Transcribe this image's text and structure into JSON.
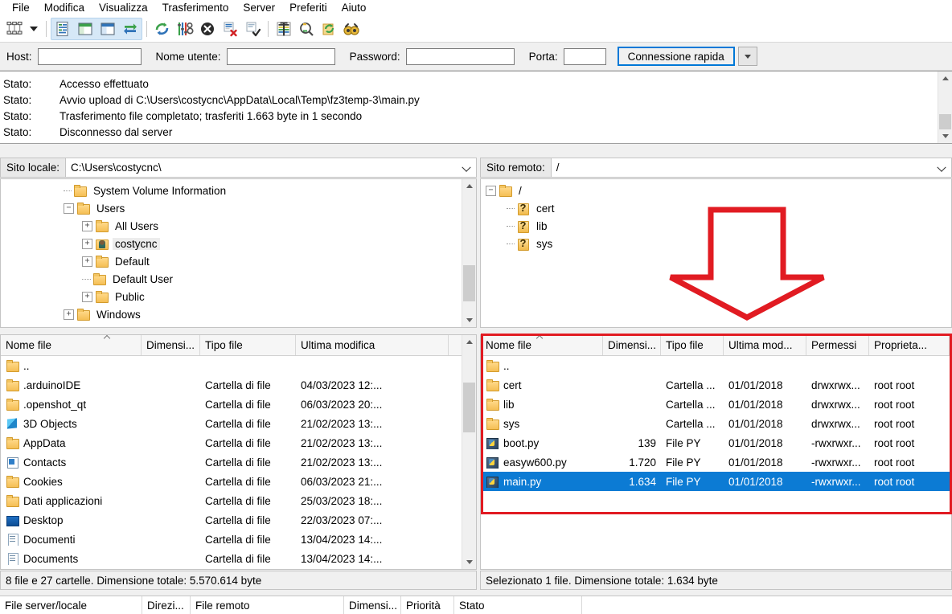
{
  "menu": {
    "items": [
      "File",
      "Modifica",
      "Visualizza",
      "Trasferimento",
      "Server",
      "Preferiti",
      "Aiuto"
    ]
  },
  "toolbar": {
    "icons": [
      "site-manager-icon",
      "site-manager-dropdown-caret",
      "toggle-message-log-icon",
      "toggle-local-tree-icon",
      "toggle-remote-tree-icon",
      "toggle-transfer-queue-icon",
      "refresh-icon",
      "process-queue-icon",
      "cancel-operation-icon",
      "disconnect-icon",
      "reconnect-icon",
      "filter-icon",
      "compare-directories-icon",
      "synchronized-browsing-icon",
      "find-files-icon"
    ]
  },
  "connection": {
    "host_label": "Host:",
    "host_value": "",
    "username_label": "Nome utente:",
    "username_value": "",
    "password_label": "Password:",
    "password_value": "",
    "port_label": "Porta:",
    "port_value": "",
    "quickconnect_label": "Connessione rapida"
  },
  "log": {
    "rows": [
      {
        "key": "Stato:",
        "text": "Accesso effettuato"
      },
      {
        "key": "Stato:",
        "text": "Avvio upload di C:\\Users\\costycnc\\AppData\\Local\\Temp\\fz3temp-3\\main.py"
      },
      {
        "key": "Stato:",
        "text": "Trasferimento file completato; trasferiti 1.663 byte in 1 secondo"
      },
      {
        "key": "Stato:",
        "text": "Disconnesso dal server"
      }
    ]
  },
  "local": {
    "path_label": "Sito locale:",
    "path_value": "C:\\Users\\costycnc\\",
    "tree": [
      {
        "label": "System Volume Information",
        "indent": 2,
        "expander": "",
        "icon": "folder-icon",
        "selected": false
      },
      {
        "label": "Users",
        "indent": 1,
        "expander": "-",
        "icon": "folder-icon",
        "selected": false
      },
      {
        "label": "All Users",
        "indent": 2,
        "expander": "+",
        "icon": "folder-icon",
        "selected": false
      },
      {
        "label": "costycnc",
        "indent": 2,
        "expander": "+",
        "icon": "user-folder-icon",
        "selected": true
      },
      {
        "label": "Default",
        "indent": 2,
        "expander": "+",
        "icon": "folder-icon",
        "selected": false
      },
      {
        "label": "Default User",
        "indent": 2,
        "expander": "",
        "icon": "folder-icon",
        "selected": false
      },
      {
        "label": "Public",
        "indent": 2,
        "expander": "+",
        "icon": "folder-icon",
        "selected": false
      },
      {
        "label": "Windows",
        "indent": 1,
        "expander": "+",
        "icon": "folder-icon",
        "selected": false
      }
    ],
    "columns": [
      "Nome file",
      "Dimensi...",
      "Tipo file",
      "Ultima modifica"
    ],
    "sorted_column": 0,
    "rows": [
      {
        "name": "..",
        "size": "",
        "type": "",
        "modified": "",
        "icon": "folder-icon"
      },
      {
        "name": ".arduinoIDE",
        "size": "",
        "type": "Cartella di file",
        "modified": "04/03/2023 12:...",
        "icon": "folder-icon"
      },
      {
        "name": ".openshot_qt",
        "size": "",
        "type": "Cartella di file",
        "modified": "06/03/2023 20:...",
        "icon": "folder-icon"
      },
      {
        "name": "3D Objects",
        "size": "",
        "type": "Cartella di file",
        "modified": "21/02/2023 13:...",
        "icon": "3d-objects-icon"
      },
      {
        "name": "AppData",
        "size": "",
        "type": "Cartella di file",
        "modified": "21/02/2023 13:...",
        "icon": "folder-icon"
      },
      {
        "name": "Contacts",
        "size": "",
        "type": "Cartella di file",
        "modified": "21/02/2023 13:...",
        "icon": "contacts-icon"
      },
      {
        "name": "Cookies",
        "size": "",
        "type": "Cartella di file",
        "modified": "06/03/2023 21:...",
        "icon": "folder-icon"
      },
      {
        "name": "Dati applicazioni",
        "size": "",
        "type": "Cartella di file",
        "modified": "25/03/2023 18:...",
        "icon": "folder-icon"
      },
      {
        "name": "Desktop",
        "size": "",
        "type": "Cartella di file",
        "modified": "22/03/2023 07:...",
        "icon": "desktop-icon"
      },
      {
        "name": "Documenti",
        "size": "",
        "type": "Cartella di file",
        "modified": "13/04/2023 14:...",
        "icon": "documents-icon"
      },
      {
        "name": "Documents",
        "size": "",
        "type": "Cartella di file",
        "modified": "13/04/2023 14:...",
        "icon": "documents-icon"
      }
    ],
    "status": "8 file e 27 cartelle. Dimensione totale: 5.570.614 byte"
  },
  "remote": {
    "path_label": "Sito remoto:",
    "path_value": "/",
    "tree": [
      {
        "label": "/",
        "indent": 0,
        "expander": "-",
        "icon": "folder-icon"
      },
      {
        "label": "cert",
        "indent": 1,
        "expander": "",
        "icon": "unknown-folder-icon"
      },
      {
        "label": "lib",
        "indent": 1,
        "expander": "",
        "icon": "unknown-folder-icon"
      },
      {
        "label": "sys",
        "indent": 1,
        "expander": "",
        "icon": "unknown-folder-icon"
      }
    ],
    "columns": [
      "Nome file",
      "Dimensi...",
      "Tipo file",
      "Ultima mod...",
      "Permessi",
      "Proprieta..."
    ],
    "sorted_column": 0,
    "rows": [
      {
        "name": "..",
        "size": "",
        "type": "",
        "modified": "",
        "perms": "",
        "owner": "",
        "icon": "folder-icon",
        "selected": false
      },
      {
        "name": "cert",
        "size": "",
        "type": "Cartella ...",
        "modified": "01/01/2018",
        "perms": "drwxrwx...",
        "owner": "root root",
        "icon": "folder-icon",
        "selected": false
      },
      {
        "name": "lib",
        "size": "",
        "type": "Cartella ...",
        "modified": "01/01/2018",
        "perms": "drwxrwx...",
        "owner": "root root",
        "icon": "folder-icon",
        "selected": false
      },
      {
        "name": "sys",
        "size": "",
        "type": "Cartella ...",
        "modified": "01/01/2018",
        "perms": "drwxrwx...",
        "owner": "root root",
        "icon": "folder-icon",
        "selected": false
      },
      {
        "name": "boot.py",
        "size": "139",
        "type": "File PY",
        "modified": "01/01/2018",
        "perms": "-rwxrwxr...",
        "owner": "root root",
        "icon": "python-file-icon",
        "selected": false
      },
      {
        "name": "easyw600.py",
        "size": "1.720",
        "type": "File PY",
        "modified": "01/01/2018",
        "perms": "-rwxrwxr...",
        "owner": "root root",
        "icon": "python-file-icon",
        "selected": false
      },
      {
        "name": "main.py",
        "size": "1.634",
        "type": "File PY",
        "modified": "01/01/2018",
        "perms": "-rwxrwxr...",
        "owner": "root root",
        "icon": "python-file-icon",
        "selected": true
      }
    ],
    "status": "Selezionato 1 file. Dimensione totale: 1.634 byte"
  },
  "queue": {
    "columns": [
      "File server/locale",
      "Direzi...",
      "File remoto",
      "Dimensi...",
      "Priorità",
      "Stato"
    ]
  },
  "annotations": {
    "arrow_color": "#e11b22",
    "highlight_color": "#e11b22"
  },
  "colors": {
    "selection_blue": "#0c7bd4",
    "quickconnect_border": "#0078d7"
  }
}
